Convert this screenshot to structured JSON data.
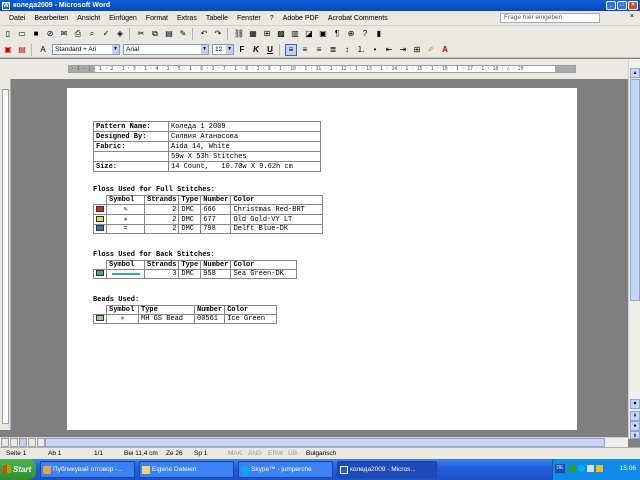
{
  "window": {
    "title": "коледа2009 - Microsoft Word"
  },
  "menu": {
    "items": [
      "Datei",
      "Bearbeiten",
      "Ansicht",
      "Einfügen",
      "Format",
      "Extras",
      "Tabelle",
      "Fenster",
      "?",
      "Adobe PDF",
      "Acrobat Comments"
    ],
    "help_placeholder": "Frage hier eingeben",
    "close_doc": "×"
  },
  "format_bar": {
    "style": "Standard + Ari",
    "font": "Arial",
    "size": "12"
  },
  "ruler_text": "· 1 · | · 1 · 2 · 1 · 3 · 1 · 4 · 1 · 5 · 1 · 6 · 1 · 7 · 1 · 8 · 1 · 9 · 1 · 10 · 1 · 11 · 1 · 12 · 1 · 13 · 1 · 14 · 1 · 15 · 1 · 16 · 1 · 17 · 1 · 18 · ⌂ · 20",
  "pattern": {
    "rows": [
      {
        "label": "Pattern Name:",
        "value": "Коледа 1 2009"
      },
      {
        "label": "Designed By:",
        "value": "Силвия Атанасова"
      },
      {
        "label": "Fabric:",
        "value": "Aida 14, White"
      },
      {
        "label": "",
        "value": "59w X 53h Stitches"
      },
      {
        "label": "Size:",
        "value": "14 Count,   10.70w X 9.62h cm"
      }
    ]
  },
  "full_stitches": {
    "heading": "Floss Used for Full Stitches:",
    "headers": [
      "Symbol",
      "Strands",
      "Type",
      "Number",
      "Color"
    ],
    "rows": [
      {
        "swatch": "#d42a2a",
        "symbol": "✎",
        "strands": "2",
        "type": "DMC",
        "number": "666",
        "color": "Christmas Red-BRT"
      },
      {
        "swatch": "#e9d36c",
        "symbol": "✳",
        "strands": "2",
        "type": "DMC",
        "number": "677",
        "color": "Old Gold-VY LT"
      },
      {
        "swatch": "#3e6fb8",
        "symbol": "=",
        "strands": "2",
        "type": "DMC",
        "number": "798",
        "color": "Delft Blue-DK"
      }
    ]
  },
  "back_stitches": {
    "heading": "Floss Used for Back Stitches:",
    "headers": [
      "Symbol",
      "Strands",
      "Type",
      "Number",
      "Color"
    ],
    "rows": [
      {
        "swatch": "#3fa89a",
        "strands": "3",
        "type": "DMC",
        "number": "958",
        "color": "Sea Green-DK"
      }
    ]
  },
  "beads": {
    "heading": "Beads Used:",
    "headers": [
      "Symbol",
      "Type",
      "Number",
      "Color"
    ],
    "rows": [
      {
        "swatch": "#9ecc9e",
        "symbol": "●",
        "type": "MH GS Bead",
        "number": "00561",
        "color": "Ice Green"
      }
    ]
  },
  "status": {
    "page": "Seite 1",
    "section": "Ab 1",
    "pages": "1/1",
    "position": "Bei 11,4 cm",
    "line": "Ze 26",
    "col": "Sp 1",
    "mak": "MAK",
    "and": "ÄND",
    "erw": "ERW",
    "ub": "ÜB",
    "lang": "Bulgarisch"
  },
  "taskbar": {
    "start": "Start",
    "buttons": [
      "Публикувай отговор -...",
      "Eigene Dateien",
      "Skype™ - jumperche",
      "коледа2009 - Micros..."
    ],
    "lang": "DE",
    "clock": "15:06"
  },
  "colors": {
    "titlebar": "#0a5fd8",
    "taskbar": "#245edb",
    "start": "#2f8e2f"
  }
}
